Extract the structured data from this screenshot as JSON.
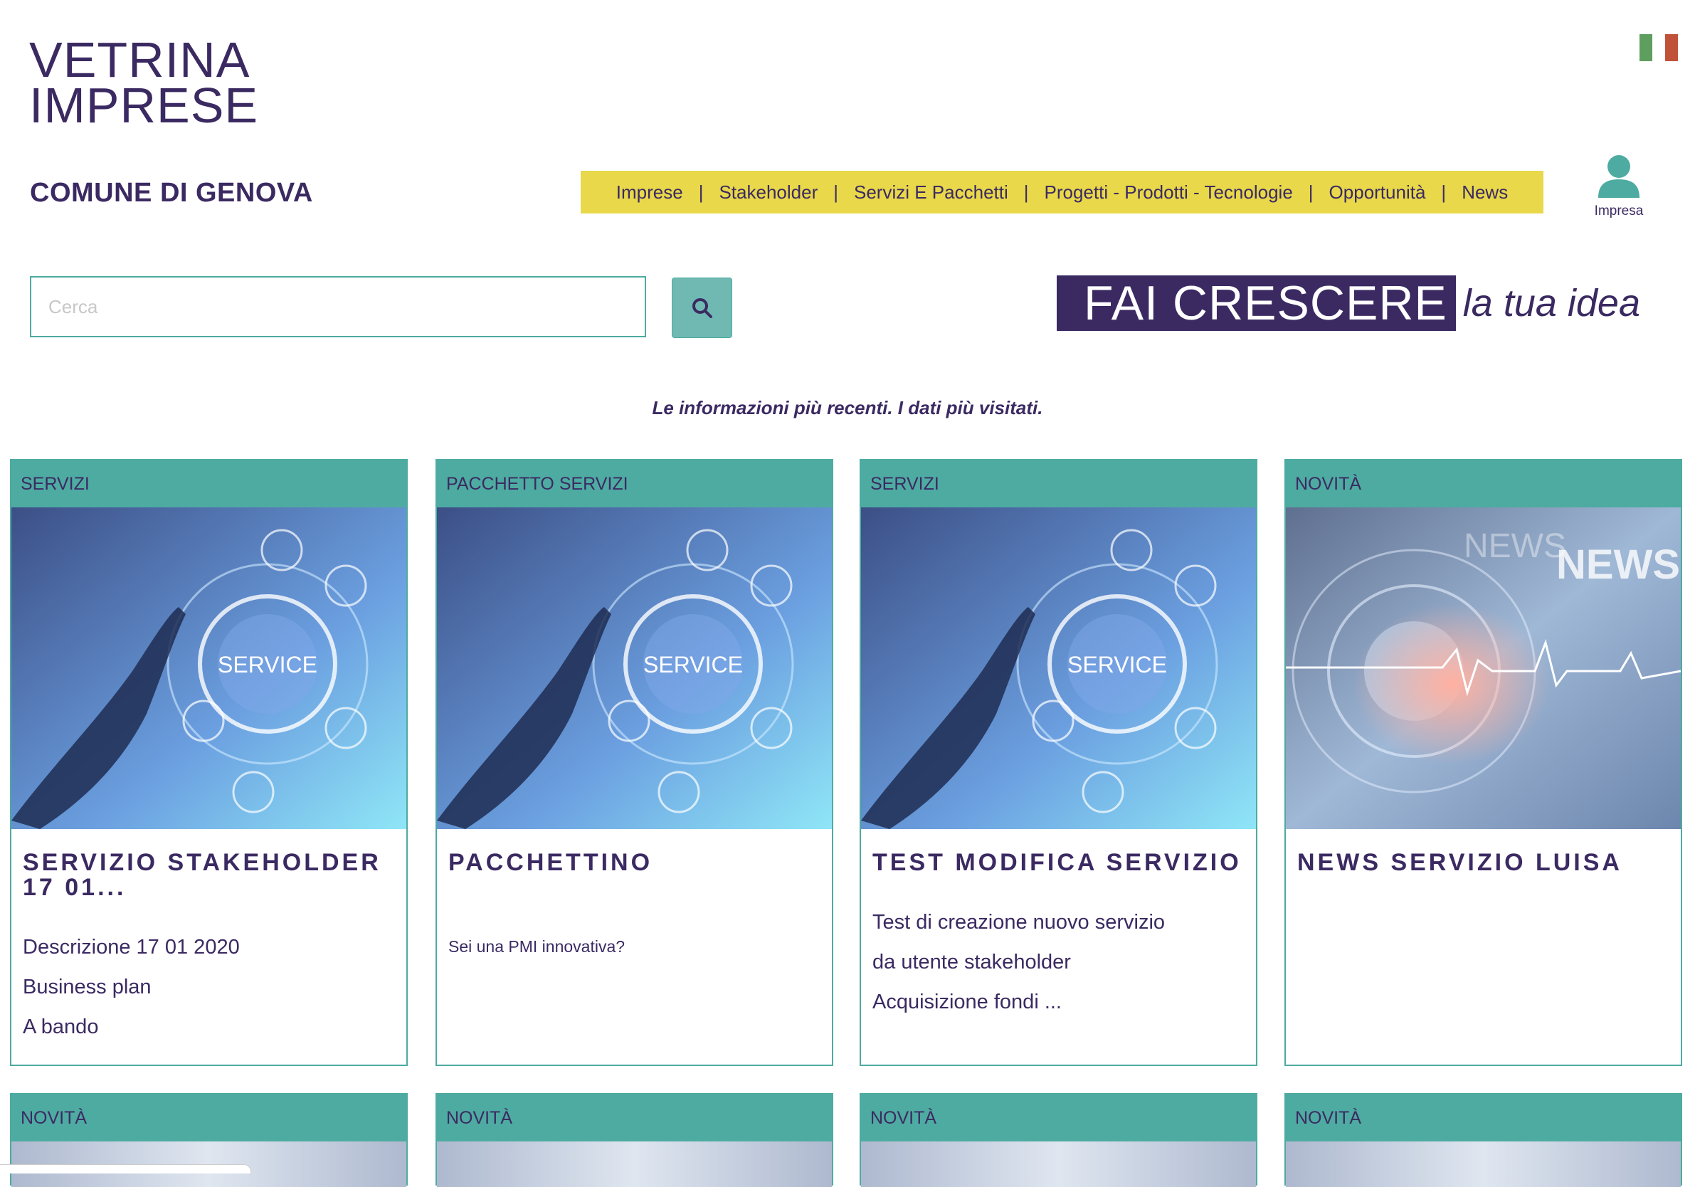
{
  "header": {
    "logo_line1": "VETRINA",
    "logo_line2": "IMPRESE",
    "city": "COMUNE DI GENOVA",
    "flag_colors": [
      "#5e9e5e",
      "#ffffff",
      "#c0523a"
    ]
  },
  "nav": {
    "items": [
      "Imprese",
      "Stakeholder",
      "Servizi E Pacchetti",
      "Progetti - Prodotti - Tecnologie",
      "Opportunità",
      "News"
    ],
    "separator": "|",
    "background": "#e8d84a"
  },
  "user": {
    "label": "Impresa",
    "icon": "user-icon"
  },
  "search": {
    "placeholder": "Cerca",
    "value": "",
    "button_icon": "search-icon"
  },
  "slogan": {
    "highlight": "FAI CRESCERE",
    "tail": "la tua idea"
  },
  "tagline": "Le informazioni più recenti. I dati più visitati.",
  "cards": [
    {
      "category": "SERVIZI",
      "image": "service-image",
      "title": "SERVIZIO STAKEHOLDER 17 01...",
      "lines": [
        "Descrizione 17 01 2020",
        "Business plan",
        "A bando"
      ]
    },
    {
      "category": "PACCHETTO SERVIZI",
      "image": "service-image",
      "title": "PACCHETTINO",
      "lines": [
        "Sei una PMI innovativa?"
      ]
    },
    {
      "category": "SERVIZI",
      "image": "service-image",
      "title": "TEST MODIFICA SERVIZIO",
      "lines": [
        "Test di creazione nuovo servizio",
        "da utente stakeholder",
        "Acquisizione fondi ..."
      ]
    },
    {
      "category": "NOVITÀ",
      "image": "news-image",
      "title": "NEWS SERVIZIO LUISA",
      "lines": []
    }
  ],
  "cards_row2": [
    {
      "category": "NOVITÀ"
    },
    {
      "category": "NOVITÀ"
    },
    {
      "category": "NOVITÀ"
    },
    {
      "category": "NOVITÀ"
    }
  ],
  "colors": {
    "primary": "#3b2a62",
    "teal": "#4eaba1",
    "yellow": "#e8d84a"
  }
}
